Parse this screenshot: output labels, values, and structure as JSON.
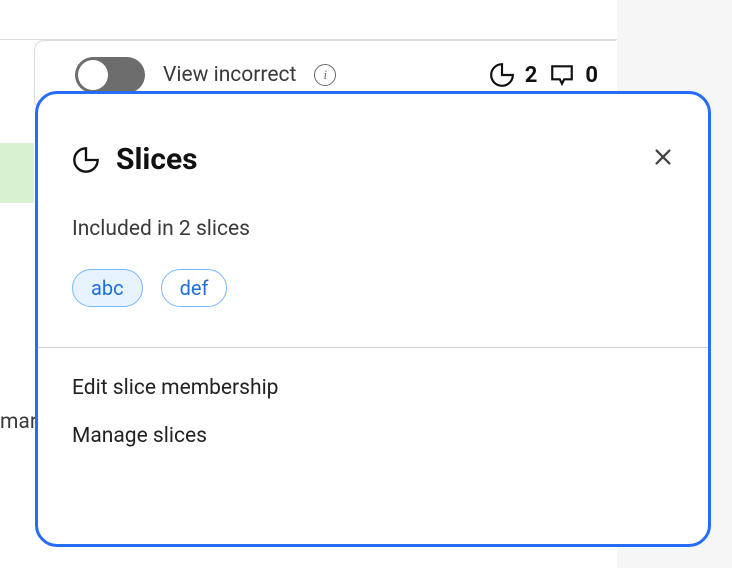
{
  "toolbar": {
    "toggle_label": "View incorrect",
    "slice_count": "2",
    "comment_count": "0"
  },
  "background": {
    "partial_text": "mar"
  },
  "popover": {
    "title": "Slices",
    "subtitle": "Included in 2 slices",
    "chips": [
      "abc",
      "def"
    ],
    "actions": {
      "edit": "Edit slice membership",
      "manage": "Manage slices"
    }
  }
}
